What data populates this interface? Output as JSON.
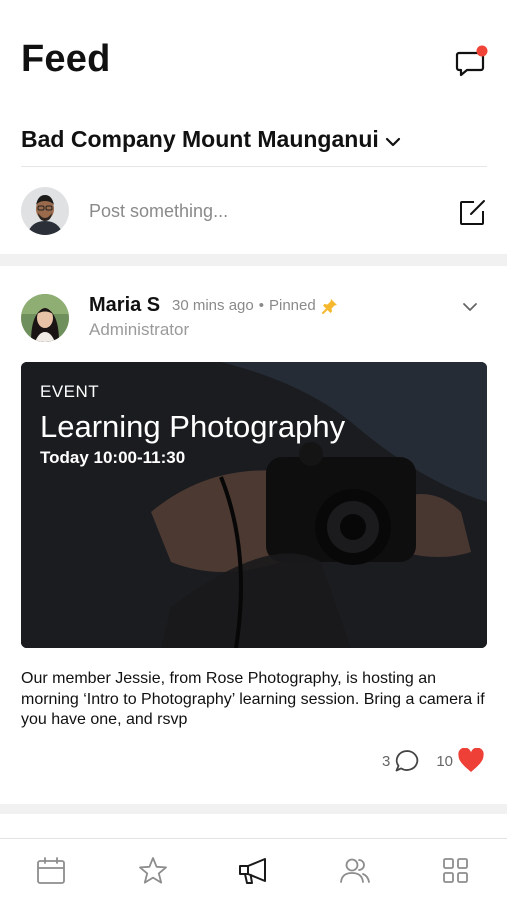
{
  "header": {
    "title": "Feed",
    "chat_icon": "chat-bubble-icon",
    "notification_dot_color": "#f04438"
  },
  "group_selector": {
    "name": "Bad Company Mount Maunganui",
    "icon": "chevron-down-icon"
  },
  "composer": {
    "placeholder": "Post something...",
    "compose_icon": "compose-icon"
  },
  "post": {
    "author": "Maria S",
    "time": "30 mins ago",
    "separator": "•",
    "status": "Pinned",
    "pin_icon": "pin-icon",
    "pin_color": "#f5b82e",
    "role": "Administrator",
    "event": {
      "label": "EVENT",
      "title": "Learning Photography",
      "time": "Today 10:00-11:30"
    },
    "body": "Our member Jessie, from Rose Photography, is hosting an morning ‘Intro to Photography’ learning session. Bring a camera if you have one, and rsvp",
    "comment_count": "3",
    "like_count": "10",
    "like_color": "#ee4036"
  },
  "tabbar": {
    "tabs": [
      {
        "icon": "calendar-icon"
      },
      {
        "icon": "star-icon"
      },
      {
        "icon": "megaphone-icon",
        "active": true
      },
      {
        "icon": "people-icon"
      },
      {
        "icon": "grid-icon"
      }
    ]
  }
}
